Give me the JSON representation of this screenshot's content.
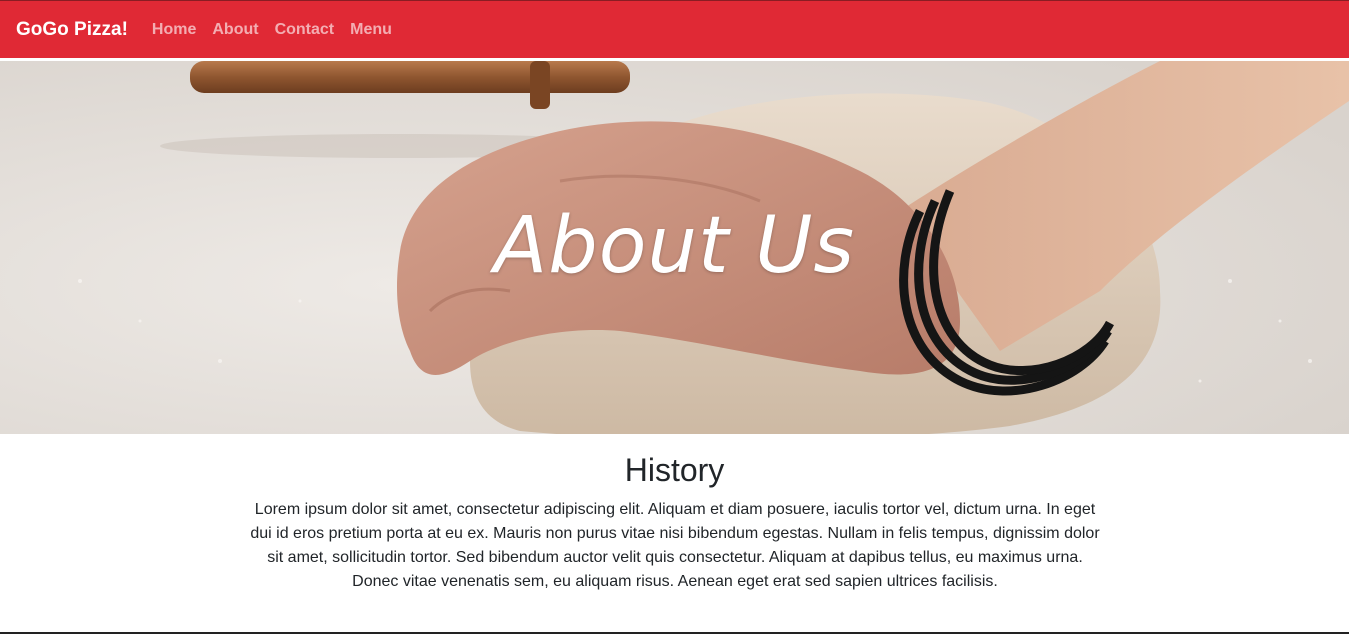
{
  "navbar": {
    "brand": "GoGo Pizza!",
    "links": [
      "Home",
      "About",
      "Contact",
      "Menu"
    ],
    "color": "#e02935"
  },
  "hero": {
    "title": "About Us"
  },
  "history": {
    "title": "History",
    "text": "Lorem ipsum dolor sit amet, consectetur adipiscing elit. Aliquam et diam posuere, iaculis tortor vel, dictum urna. In eget dui id eros pretium porta at eu ex. Mauris non purus vitae nisi bibendum egestas. Nullam in felis tempus, dignissim dolor sit amet, sollicitudin tortor. Sed bibendum auctor velit quis consectetur. Aliquam at dapibus tellus, eu maximus urna. Donec vitae venenatis sem, eu aliquam risus. Aenean eget erat sed sapien ultrices facilisis."
  }
}
